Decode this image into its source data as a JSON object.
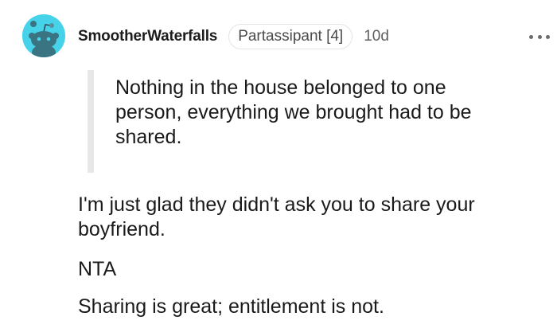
{
  "comment": {
    "username": "SmootherWaterfalls",
    "flair": "Partassipant [4]",
    "timestamp": "10d",
    "more_icon": "more-options-icon",
    "avatar_icon": "snoo-avatar-icon",
    "avatar_color": "#46d3ea",
    "quote": "Nothing in the house belonged to one person, everything we brought had to be shared.",
    "paragraphs": [
      "I'm just glad they didn't ask you to share your boyfriend.",
      "NTA",
      "Sharing is great; entitlement is not."
    ]
  }
}
